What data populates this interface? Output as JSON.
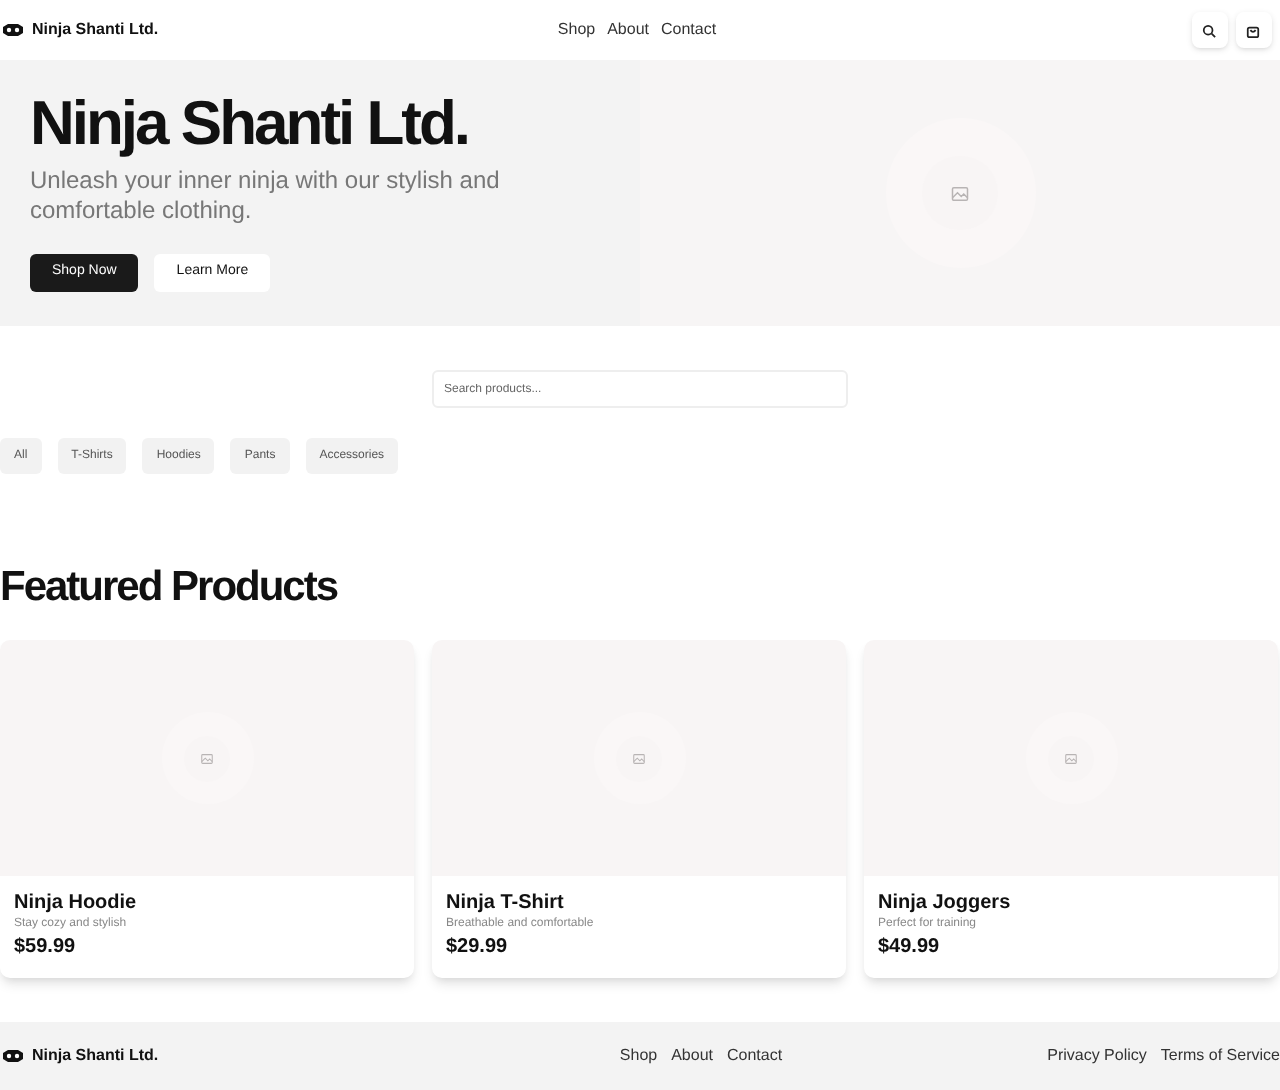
{
  "header": {
    "brand": "Ninja Shanti Ltd.",
    "nav": [
      "Shop",
      "About",
      "Contact"
    ]
  },
  "hero": {
    "title": "Ninja Shanti Ltd.",
    "subtitle": "Unleash your inner ninja with our stylish and comfortable clothing.",
    "buttons": [
      {
        "label": "Shop Now",
        "kind": "primary"
      },
      {
        "label": "Learn More",
        "kind": "secondary"
      }
    ]
  },
  "search": {
    "placeholder": "Search products..."
  },
  "filters": [
    "All",
    "T-Shirts",
    "Hoodies",
    "Pants",
    "Accessories"
  ],
  "featured": {
    "title": "Featured Products",
    "products": [
      {
        "name": "Ninja Hoodie",
        "description": "Stay cozy and stylish",
        "price": "$59.99"
      },
      {
        "name": "Ninja T-Shirt",
        "description": "Breathable and comfortable",
        "price": "$29.99"
      },
      {
        "name": "Ninja Joggers",
        "description": "Perfect for training",
        "price": "$49.99"
      }
    ]
  },
  "footer": {
    "brand": "Ninja Shanti Ltd.",
    "nav": [
      "Shop",
      "About",
      "Contact"
    ],
    "legal": [
      "Privacy Policy",
      "Terms of Service"
    ]
  }
}
